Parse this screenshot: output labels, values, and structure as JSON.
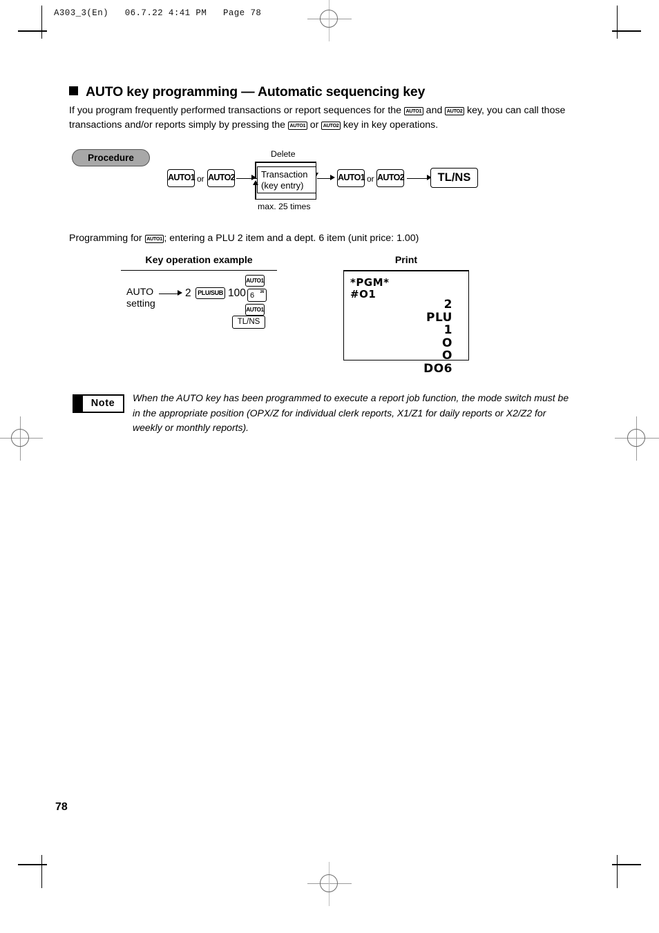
{
  "page": {
    "running_head": "A303_3(En)   06.7.22 4:41 PM   Page 78",
    "folio": "78"
  },
  "section": {
    "title": "AUTO key programming — Automatic sequencing key",
    "intro_part1": "If you program frequently performed transactions or report sequences for the ",
    "intro_key1": "AUTO1",
    "intro_part2": " and ",
    "intro_key2": "AUTO2",
    "intro_part3": " key, you can call those transactions and/or reports simply by pressing the ",
    "intro_key3": "AUTO1",
    "intro_part4": " or ",
    "intro_key4": "AUTO2",
    "intro_part5": " key in key operations."
  },
  "procedure": {
    "badge_label": "Procedure",
    "key_auto1_a": "AUTO1",
    "or_a": "or",
    "key_auto2_a": "AUTO2",
    "delete_label": "Delete",
    "transaction_line1": "Transaction",
    "transaction_line2": "(key entry)",
    "max_label": "max. 25 times",
    "key_auto1_b": "AUTO1",
    "or_b": "or",
    "key_auto2_b": "AUTO2",
    "key_tlns": "TL/NS"
  },
  "programming_line": {
    "part1": "Programming for ",
    "key": "AUTO1",
    "part2": "; entering a PLU 2 item and a dept. 6 item (unit price: 1.00)"
  },
  "example": {
    "key_column_header": "Key operation example",
    "print_column_header": "Print",
    "auto_setting_line1": "AUTO",
    "auto_setting_line2": "setting",
    "seq_plu_number": "2",
    "key_plusub": "PLU/SUB",
    "seq_price": "100",
    "key_dept_main": "6",
    "key_dept_sup": "26",
    "key_auto1_top": "AUTO1",
    "key_auto1_bottom": "AUTO1",
    "key_tlns": "TL/NS"
  },
  "receipt": {
    "left_lines": [
      "*PGM*",
      "#O1"
    ],
    "right_lines": [
      "2",
      "PLU",
      "1",
      "O",
      "O",
      "DO6"
    ]
  },
  "note": {
    "badge_label": "Note",
    "text": "When the AUTO key has been programmed to execute a report job function, the mode switch must be in the appropriate position (OPX/Z for individual clerk reports, X1/Z1 for daily reports or X2/Z2 for weekly or monthly reports)."
  },
  "colors": {
    "ink": "#000000",
    "paper": "#ffffff",
    "badge_gray": "#a8a8a8",
    "regmark_gray": "#6b6b6b"
  }
}
